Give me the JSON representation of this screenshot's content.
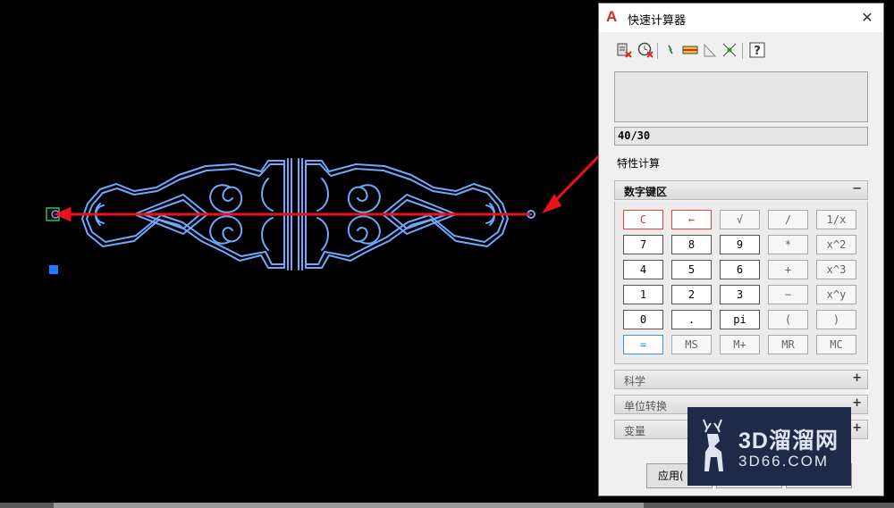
{
  "window": {
    "title": "快速计算器"
  },
  "toolbar": {
    "icons": [
      "clear-icon",
      "clear-history-icon",
      "get-point-icon",
      "distance-icon",
      "angle-icon",
      "intersection-icon",
      "help-icon"
    ]
  },
  "display": {
    "history": "",
    "input": "40/30"
  },
  "property_link": "特性计算",
  "sections": {
    "numpad": {
      "label": "数字键区",
      "sign": "−"
    },
    "science": {
      "label": "科学",
      "sign": "+"
    },
    "units": {
      "label": "单位转换",
      "sign": "+"
    },
    "variables": {
      "label": "变量",
      "sign": "+"
    }
  },
  "keys": [
    [
      "C",
      "←",
      "√",
      "/",
      "1/x"
    ],
    [
      "7",
      "8",
      "9",
      "*",
      "x^2"
    ],
    [
      "4",
      "5",
      "6",
      "+",
      "x^3"
    ],
    [
      "1",
      "2",
      "3",
      "−",
      "x^y"
    ],
    [
      "0",
      ".",
      "pi",
      "(",
      ")"
    ],
    [
      "=",
      "MS",
      "M+",
      "MR",
      "MC"
    ]
  ],
  "bottom_buttons": {
    "apply": "应用("
  },
  "watermark": {
    "title": "3D溜溜网",
    "subtitle": "3D66.COM"
  },
  "colors": {
    "arrow": "#e8141a",
    "drawing_lines": "#6fa8ff",
    "accent_red": "#d42b20"
  }
}
